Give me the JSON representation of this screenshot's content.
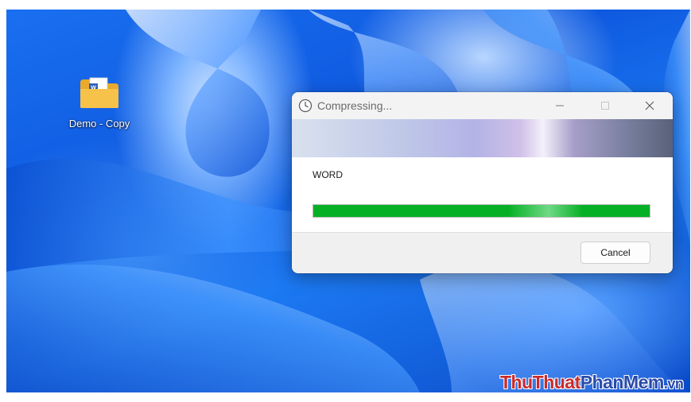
{
  "desktop": {
    "icons": [
      {
        "label": "Demo - Copy",
        "icon": "folder-with-word-document-icon"
      }
    ]
  },
  "dialog": {
    "title": "Compressing...",
    "title_icon": "clock-icon",
    "controls": {
      "minimize": "minimize-icon",
      "maximize": "maximize-icon",
      "close": "close-icon"
    },
    "item_name": "WORD",
    "progress_fraction": 1.0,
    "progress_color": "#06b025",
    "cancel_label": "Cancel"
  },
  "watermark": {
    "part1": "ThuThuat",
    "part2": "PhanMem",
    "part3": ".vn",
    "colors": {
      "part1": "#c92a2a",
      "part2": "#2b4aa8"
    }
  }
}
